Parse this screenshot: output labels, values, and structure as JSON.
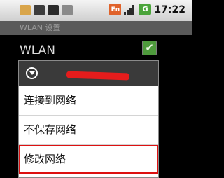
{
  "status_bar": {
    "left_icons": [
      "usb-icon",
      "debug-icon",
      "sdcard-icon",
      "notification-icon"
    ],
    "input_badge": "En",
    "battery_badge": "G",
    "time": "17:22"
  },
  "title_bar": {
    "title": "WLAN 设置"
  },
  "settings": {
    "wlan_label": "WLAN",
    "wlan_checked": true
  },
  "dialog": {
    "title": "",
    "items": [
      {
        "label": "连接到网络"
      },
      {
        "label": "不保存网络"
      },
      {
        "label": "修改网络",
        "highlighted": true
      }
    ]
  },
  "colors": {
    "accent_green": "#4e9a3c",
    "highlight_red": "#d11111",
    "dialog_header": "#3a3a3a"
  }
}
